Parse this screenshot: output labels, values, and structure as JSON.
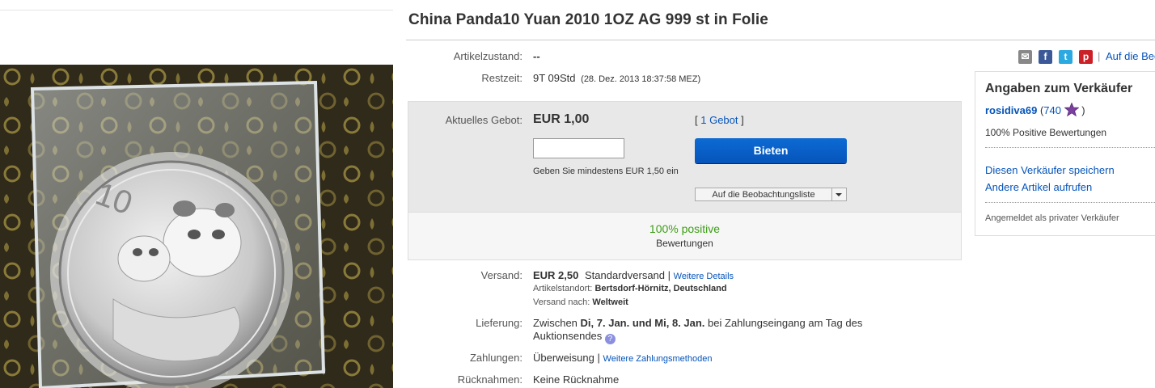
{
  "title": "China Panda10 Yuan 2010 1OZ AG 999 st in Folie",
  "icons": {
    "email": "email-icon",
    "facebook": "facebook-icon",
    "twitter": "twitter-icon",
    "pinterest": "pinterest-icon",
    "help": "help-icon",
    "star": "purple-star-icon",
    "caret": "chevron-down-icon"
  },
  "colors": {
    "accent": "#0654ba",
    "positive": "#3c9d16",
    "star": "#7b3fa0"
  },
  "share": {
    "separator": "|",
    "watch_link": "Auf die Beo"
  },
  "condition": {
    "label": "Artikelzustand:",
    "value": "--"
  },
  "time_left": {
    "label": "Restzeit:",
    "value": "9T 09Std",
    "detail": "(28. Dez. 2013  18:37:58 MEZ)"
  },
  "bid": {
    "label": "Aktuelles Gebot:",
    "price": "EUR 1,00",
    "count_open": "[",
    "count_link": "1 Gebot",
    "count_close": "]",
    "input_value": "",
    "button_label": "Bieten",
    "hint": "Geben Sie mindestens EUR 1,50 ein",
    "watch_label": "Auf die Beobachtungsliste"
  },
  "feedback": {
    "percent": "100% positive",
    "label": "Bewertungen"
  },
  "shipping": {
    "label": "Versand:",
    "cost": "EUR 2,50",
    "method": "Standardversand",
    "separator": "|",
    "details_link": "Weitere Details",
    "location_label": "Artikelstandort:",
    "location_value": "Bertsdorf-Hörnitz, Deutschland",
    "to_label": "Versand nach:",
    "to_value": "Weltweit"
  },
  "delivery": {
    "label": "Lieferung:",
    "prefix": "Zwischen",
    "dates": "Di, 7. Jan. und Mi, 8. Jan.",
    "suffix": "bei Zahlungseingang am Tag des",
    "line2": "Auktionsendes"
  },
  "payment": {
    "label": "Zahlungen:",
    "value": "Überweisung",
    "separator": "|",
    "more_link": "Weitere Zahlungsmethoden"
  },
  "returns": {
    "label": "Rücknahmen:",
    "value": "Keine Rücknahme"
  },
  "seller": {
    "heading": "Angaben zum Verkäufer",
    "name": "rosidiva69",
    "score_open": "(",
    "score": "740",
    "score_close": ")",
    "positive": "100% Positive Bewertungen",
    "save_link": "Diesen Verkäufer speichern",
    "other_link": "Andere Artikel aufrufen",
    "type": "Angemeldet als privater Verkäufer"
  },
  "photo": {
    "coin_value": "10"
  }
}
